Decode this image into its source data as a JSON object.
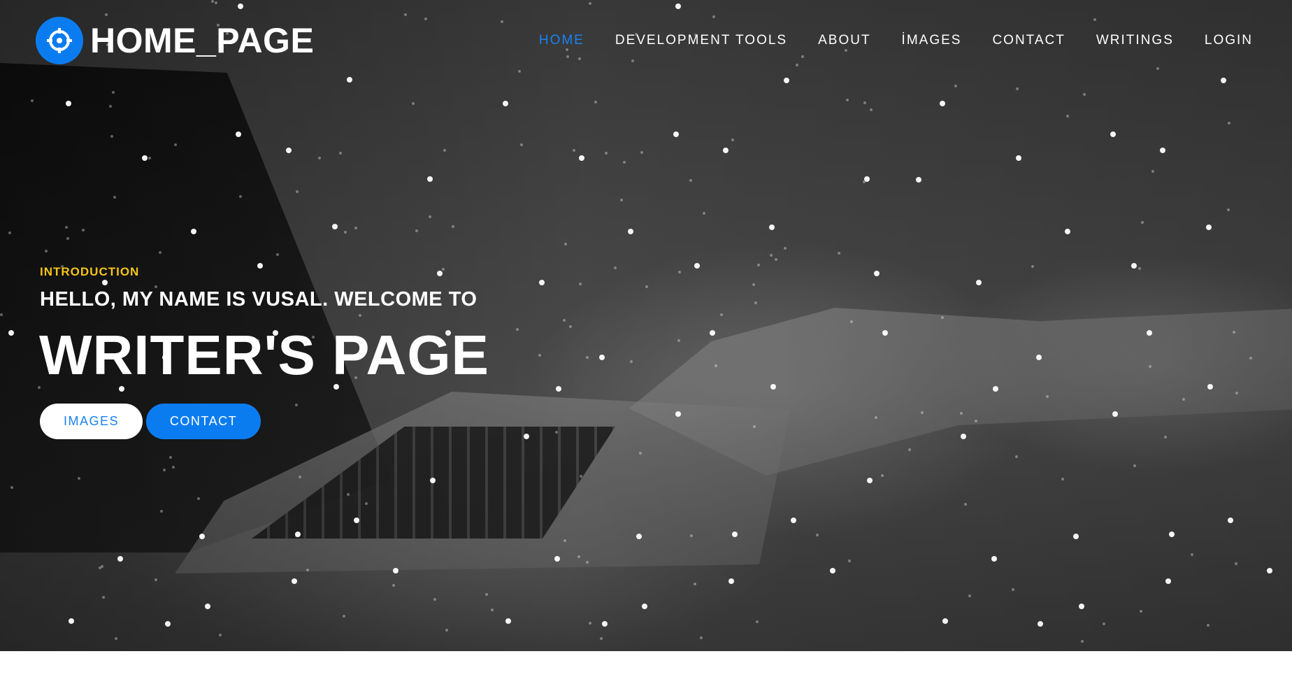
{
  "brand": {
    "title": "HOME_PAGE",
    "icon": "crosshair-icon",
    "accent_color": "#0b7cf0"
  },
  "nav": {
    "items": [
      {
        "label": "HOME",
        "active": true
      },
      {
        "label": "DEVELOPMENT TOOLS",
        "active": false
      },
      {
        "label": "ABOUT",
        "active": false
      },
      {
        "label": "İMAGES",
        "active": false
      },
      {
        "label": "CONTACT",
        "active": false
      },
      {
        "label": "WRITINGS",
        "active": false
      },
      {
        "label": "LOGIN",
        "active": false
      }
    ],
    "active_color": "#1a82f2"
  },
  "hero": {
    "eyebrow": "INTRODUCTION",
    "eyebrow_color": "#f5c518",
    "subtitle": "HELLO, MY NAME IS VUSAL. WELCOME TO",
    "title": "WRITER'S PAGE",
    "buttons": {
      "images_label": "IMAGES",
      "contact_label": "CONTACT"
    }
  }
}
